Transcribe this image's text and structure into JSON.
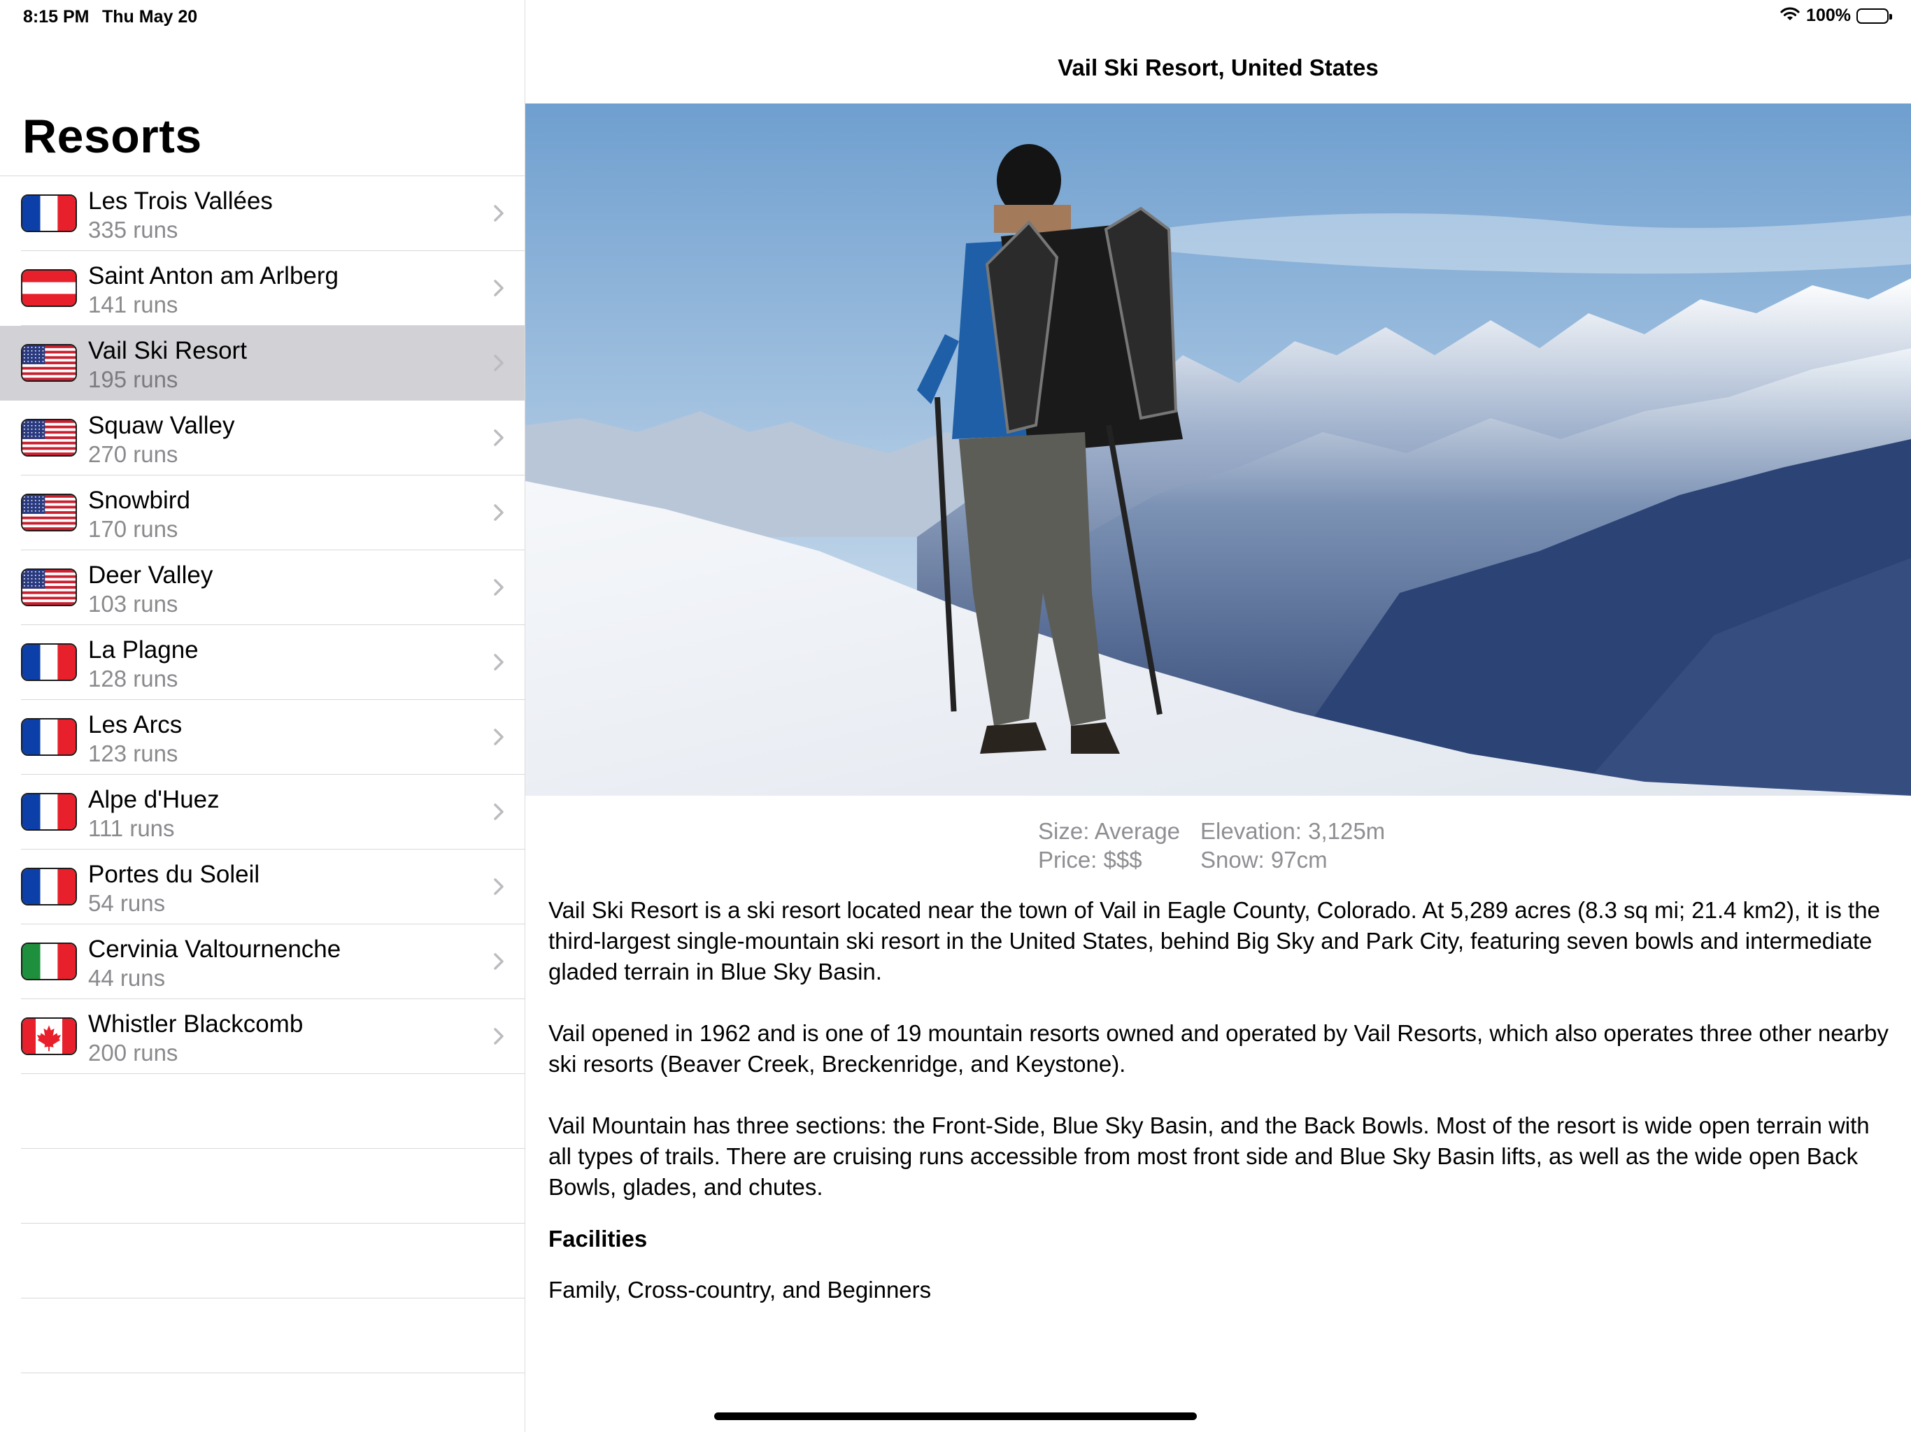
{
  "status_bar": {
    "time": "8:15 PM",
    "date": "Thu May 20",
    "battery_percent": "100%",
    "battery_level": 1.0,
    "wifi_icon": "wifi-icon",
    "battery_icon": "battery-icon"
  },
  "sidebar": {
    "title": "Resorts",
    "selected_index": 2,
    "resorts": [
      {
        "name": "Les Trois Vallées",
        "runs": "335 runs",
        "flag": "france-flag-icon"
      },
      {
        "name": "Saint Anton am Arlberg",
        "runs": "141 runs",
        "flag": "austria-flag-icon"
      },
      {
        "name": "Vail Ski Resort",
        "runs": "195 runs",
        "flag": "usa-flag-icon"
      },
      {
        "name": "Squaw Valley",
        "runs": "270 runs",
        "flag": "usa-flag-icon"
      },
      {
        "name": "Snowbird",
        "runs": "170 runs",
        "flag": "usa-flag-icon"
      },
      {
        "name": "Deer Valley",
        "runs": "103 runs",
        "flag": "usa-flag-icon"
      },
      {
        "name": "La Plagne",
        "runs": "128 runs",
        "flag": "france-flag-icon"
      },
      {
        "name": "Les Arcs",
        "runs": "123 runs",
        "flag": "france-flag-icon"
      },
      {
        "name": "Alpe d'Huez",
        "runs": "111 runs",
        "flag": "france-flag-icon"
      },
      {
        "name": "Portes du Soleil",
        "runs": "54 runs",
        "flag": "france-flag-icon"
      },
      {
        "name": "Cervinia Valtournenche",
        "runs": "44 runs",
        "flag": "italy-flag-icon"
      },
      {
        "name": "Whistler Blackcomb",
        "runs": "200 runs",
        "flag": "canada-flag-icon"
      }
    ]
  },
  "detail": {
    "title": "Vail Ski Resort, United States",
    "stats": {
      "size": "Size: Average",
      "elevation": "Elevation: 3,125m",
      "price": "Price: $$$",
      "snow": "Snow: 97cm"
    },
    "description": [
      "Vail Ski Resort is a ski resort located near the town of Vail in Eagle County, Colorado. At 5,289 acres (8.3 sq mi; 21.4 km2), it is the third-largest single-mountain ski resort in the United States, behind Big Sky and Park City, featuring seven bowls and intermediate gladed terrain in Blue Sky Basin.",
      "Vail opened in 1962 and is one of 19 mountain resorts owned and operated by Vail Resorts, which also operates three other nearby ski resorts (Beaver Creek, Breckenridge, and Keystone).",
      "Vail Mountain has three sections: the Front-Side, Blue Sky Basin, and the Back Bowls. Most of the resort is wide open terrain with all types of trails. There are cruising runs accessible from most front side and Blue Sky Basin lifts, as well as the wide open Back Bowls, glades, and chutes."
    ],
    "facilities_heading": "Facilities",
    "facilities": "Family, Cross-country, and Beginners"
  },
  "colors": {
    "selected_row": "#d1d1d6",
    "secondary_text": "#8a8a8e",
    "separator": "#d8d8d8"
  }
}
